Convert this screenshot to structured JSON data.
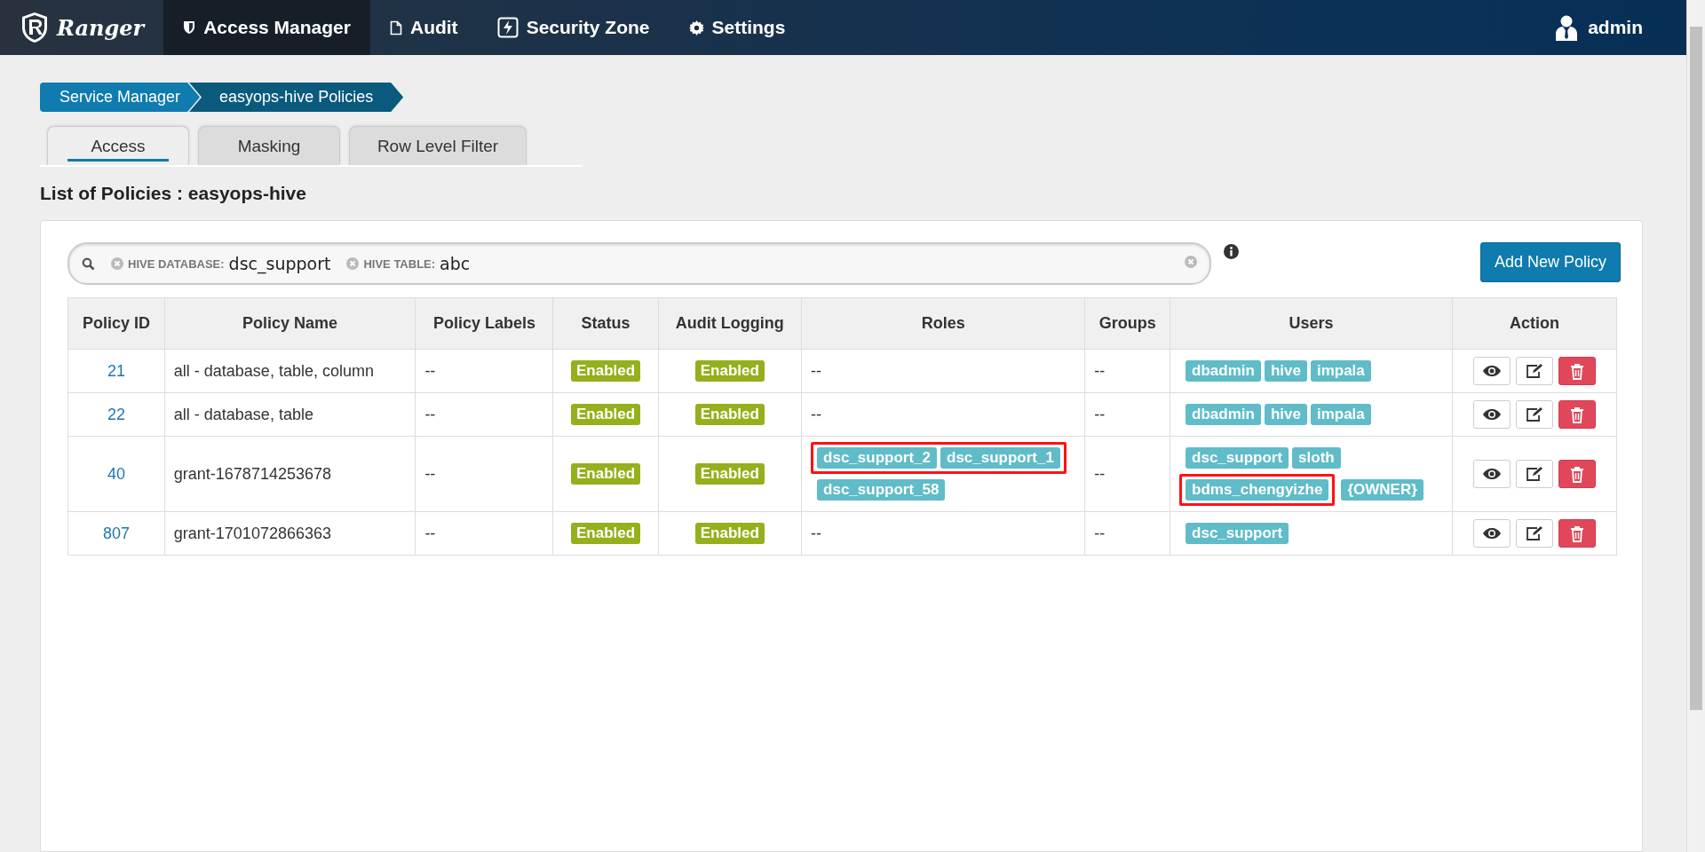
{
  "nav": {
    "brand": "Ranger",
    "items": [
      {
        "label": "Access Manager",
        "selected": true
      },
      {
        "label": "Audit",
        "selected": false
      },
      {
        "label": "Security Zone",
        "selected": false
      },
      {
        "label": "Settings",
        "selected": false
      }
    ],
    "user": "admin"
  },
  "breadcrumb": [
    "Service Manager",
    "easyops-hive Policies"
  ],
  "tabs": [
    {
      "label": "Access",
      "selected": true
    },
    {
      "label": "Masking",
      "selected": false
    },
    {
      "label": "Row Level Filter",
      "selected": false
    }
  ],
  "title": "List of Policies : easyops-hive",
  "search": {
    "filters": [
      {
        "label": "HIVE DATABASE:",
        "value": "dsc_support"
      },
      {
        "label": "HIVE TABLE:",
        "value": "abc"
      }
    ]
  },
  "add_button": "Add New Policy",
  "table": {
    "columns": [
      "Policy ID",
      "Policy Name",
      "Policy Labels",
      "Status",
      "Audit Logging",
      "Roles",
      "Groups",
      "Users",
      "Action"
    ],
    "rows": [
      {
        "id": "21",
        "name": "all - database, table, column",
        "labels": "--",
        "status": {
          "text": "Enabled",
          "enabled": true
        },
        "audit": {
          "text": "Enabled",
          "enabled": true
        },
        "roles": "--",
        "groups": "--",
        "users": [
          {
            "tags": [
              "dbadmin",
              "hive",
              "impala"
            ],
            "highlighted": false
          }
        ]
      },
      {
        "id": "22",
        "name": "all - database, table",
        "labels": "--",
        "status": {
          "text": "Enabled",
          "enabled": true
        },
        "audit": {
          "text": "Enabled",
          "enabled": true
        },
        "roles": "--",
        "groups": "--",
        "users": [
          {
            "tags": [
              "dbadmin",
              "hive",
              "impala"
            ],
            "highlighted": false
          }
        ]
      },
      {
        "id": "40",
        "name": "grant-1678714253678",
        "labels": "--",
        "status": {
          "text": "Enabled",
          "enabled": true
        },
        "audit": {
          "text": "Enabled",
          "enabled": true
        },
        "roles": [
          {
            "tags": [
              "dsc_support_2",
              "dsc_support_1"
            ],
            "highlighted": true
          },
          {
            "tags": [
              "dsc_support_58"
            ],
            "highlighted": false
          }
        ],
        "groups": "--",
        "users": [
          {
            "tags": [
              "dsc_support",
              "sloth"
            ],
            "highlighted": false
          },
          {
            "tags": [
              "bdms_chengyizhe"
            ],
            "highlighted": true
          },
          {
            "tags": [
              "{OWNER}"
            ],
            "highlighted": false
          }
        ]
      },
      {
        "id": "807",
        "name": "grant-1701072866363",
        "labels": "--",
        "status": {
          "text": "Enabled",
          "enabled": true
        },
        "audit": {
          "text": "Enabled",
          "enabled": true
        },
        "roles": "--",
        "groups": "--",
        "users": [
          {
            "tags": [
              "dsc_support"
            ],
            "highlighted": false
          }
        ]
      }
    ]
  }
}
